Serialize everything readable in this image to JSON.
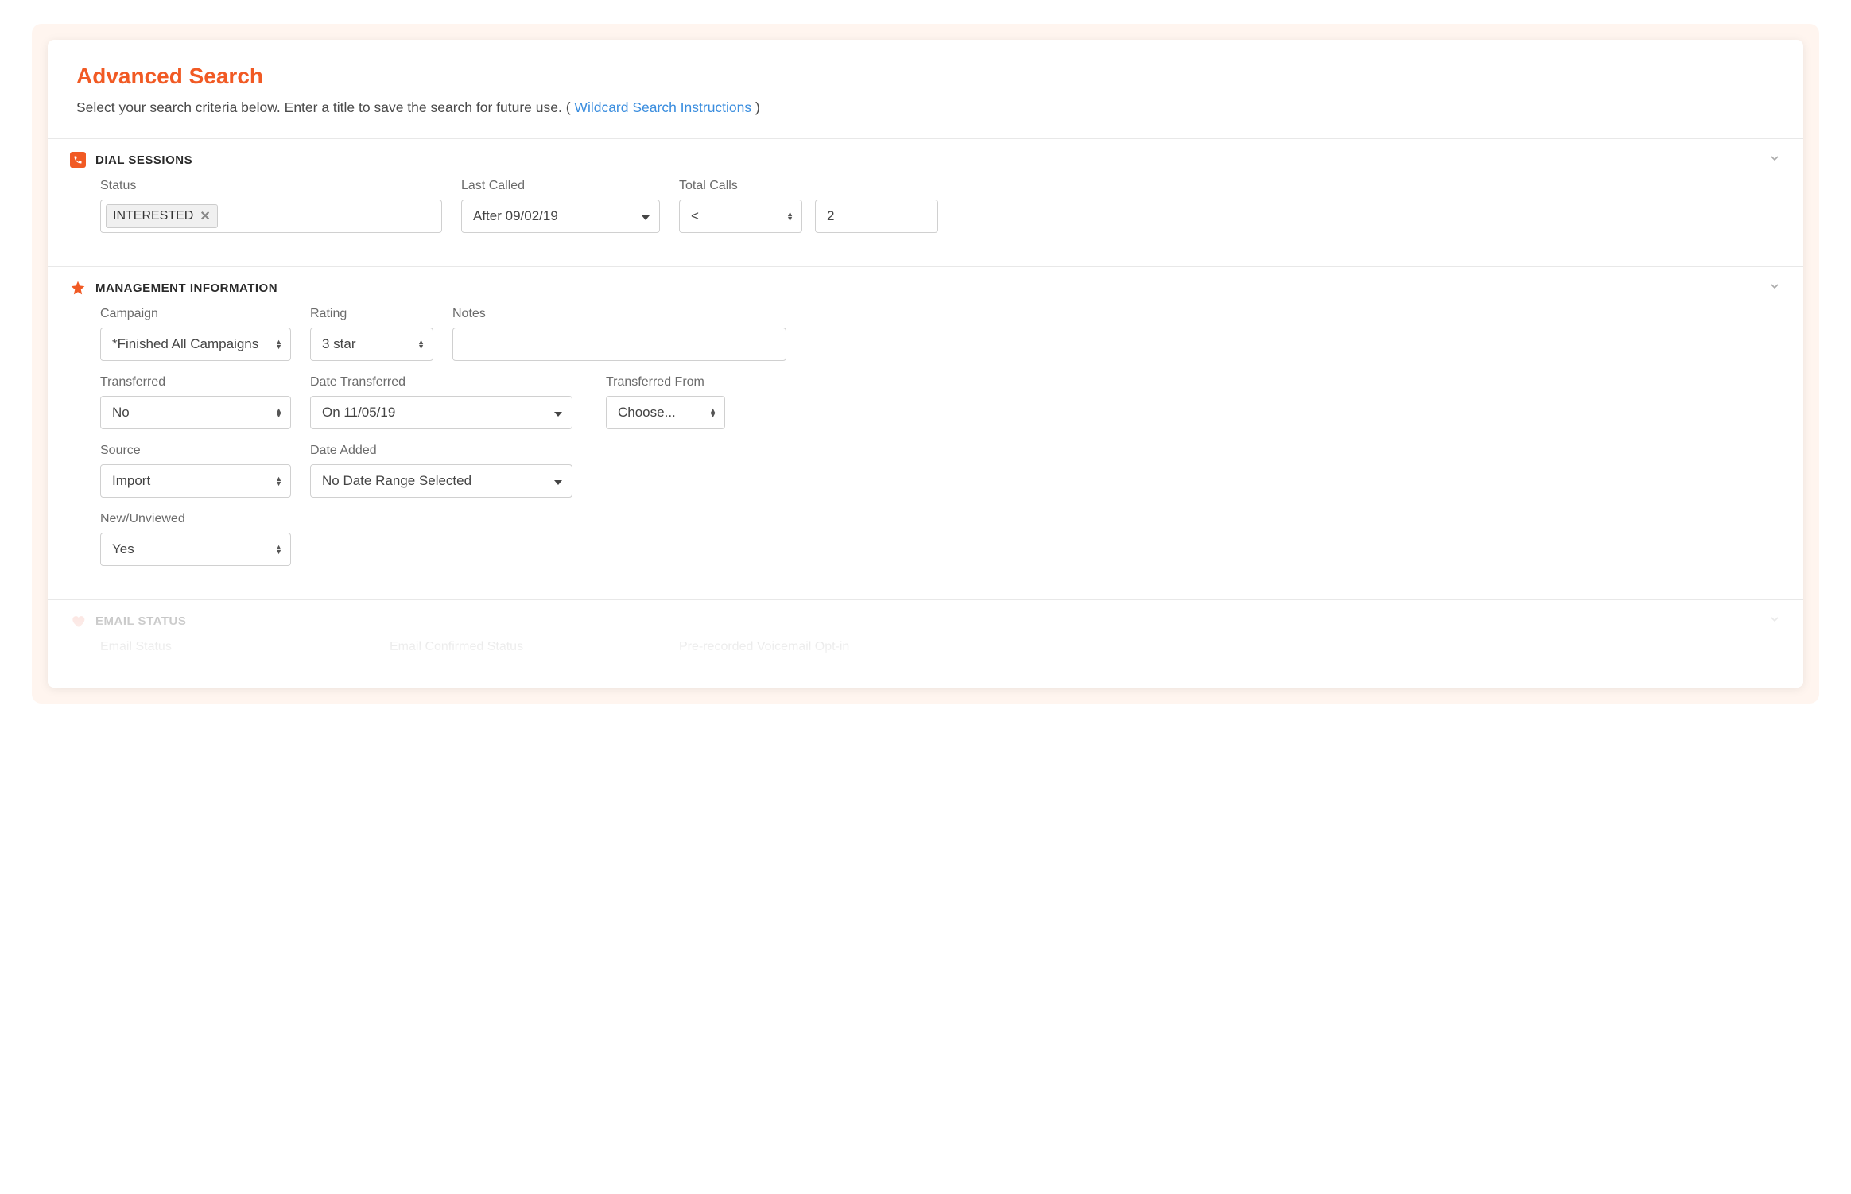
{
  "header": {
    "title": "Advanced Search",
    "subtitle_prefix": "Select your search criteria below. Enter a title to save the search for future use. ( ",
    "wildcard_link": "Wildcard Search Instructions",
    "subtitle_suffix": " )"
  },
  "dial_sessions": {
    "section_title": "DIAL SESSIONS",
    "status_label": "Status",
    "status_tag": "INTERESTED",
    "last_called_label": "Last Called",
    "last_called_value": "After 09/02/19",
    "total_calls_label": "Total Calls",
    "total_calls_operator": "<",
    "total_calls_value": "2"
  },
  "management": {
    "section_title": "MANAGEMENT INFORMATION",
    "campaign_label": "Campaign",
    "campaign_value": "*Finished All Campaigns",
    "rating_label": "Rating",
    "rating_value": "3 star",
    "notes_label": "Notes",
    "notes_value": "",
    "transferred_label": "Transferred",
    "transferred_value": "No",
    "date_transferred_label": "Date Transferred",
    "date_transferred_value": "On 11/05/19",
    "transferred_from_label": "Transferred From",
    "transferred_from_value": "Choose...",
    "source_label": "Source",
    "source_value": "Import",
    "date_added_label": "Date Added",
    "date_added_value": "No Date Range Selected",
    "new_unviewed_label": "New/Unviewed",
    "new_unviewed_value": "Yes"
  },
  "email_status": {
    "section_title": "EMAIL STATUS",
    "email_status_label": "Email Status",
    "email_confirmed_label": "Email Confirmed Status",
    "voicemail_label": "Pre-recorded Voicemail Opt-in"
  }
}
